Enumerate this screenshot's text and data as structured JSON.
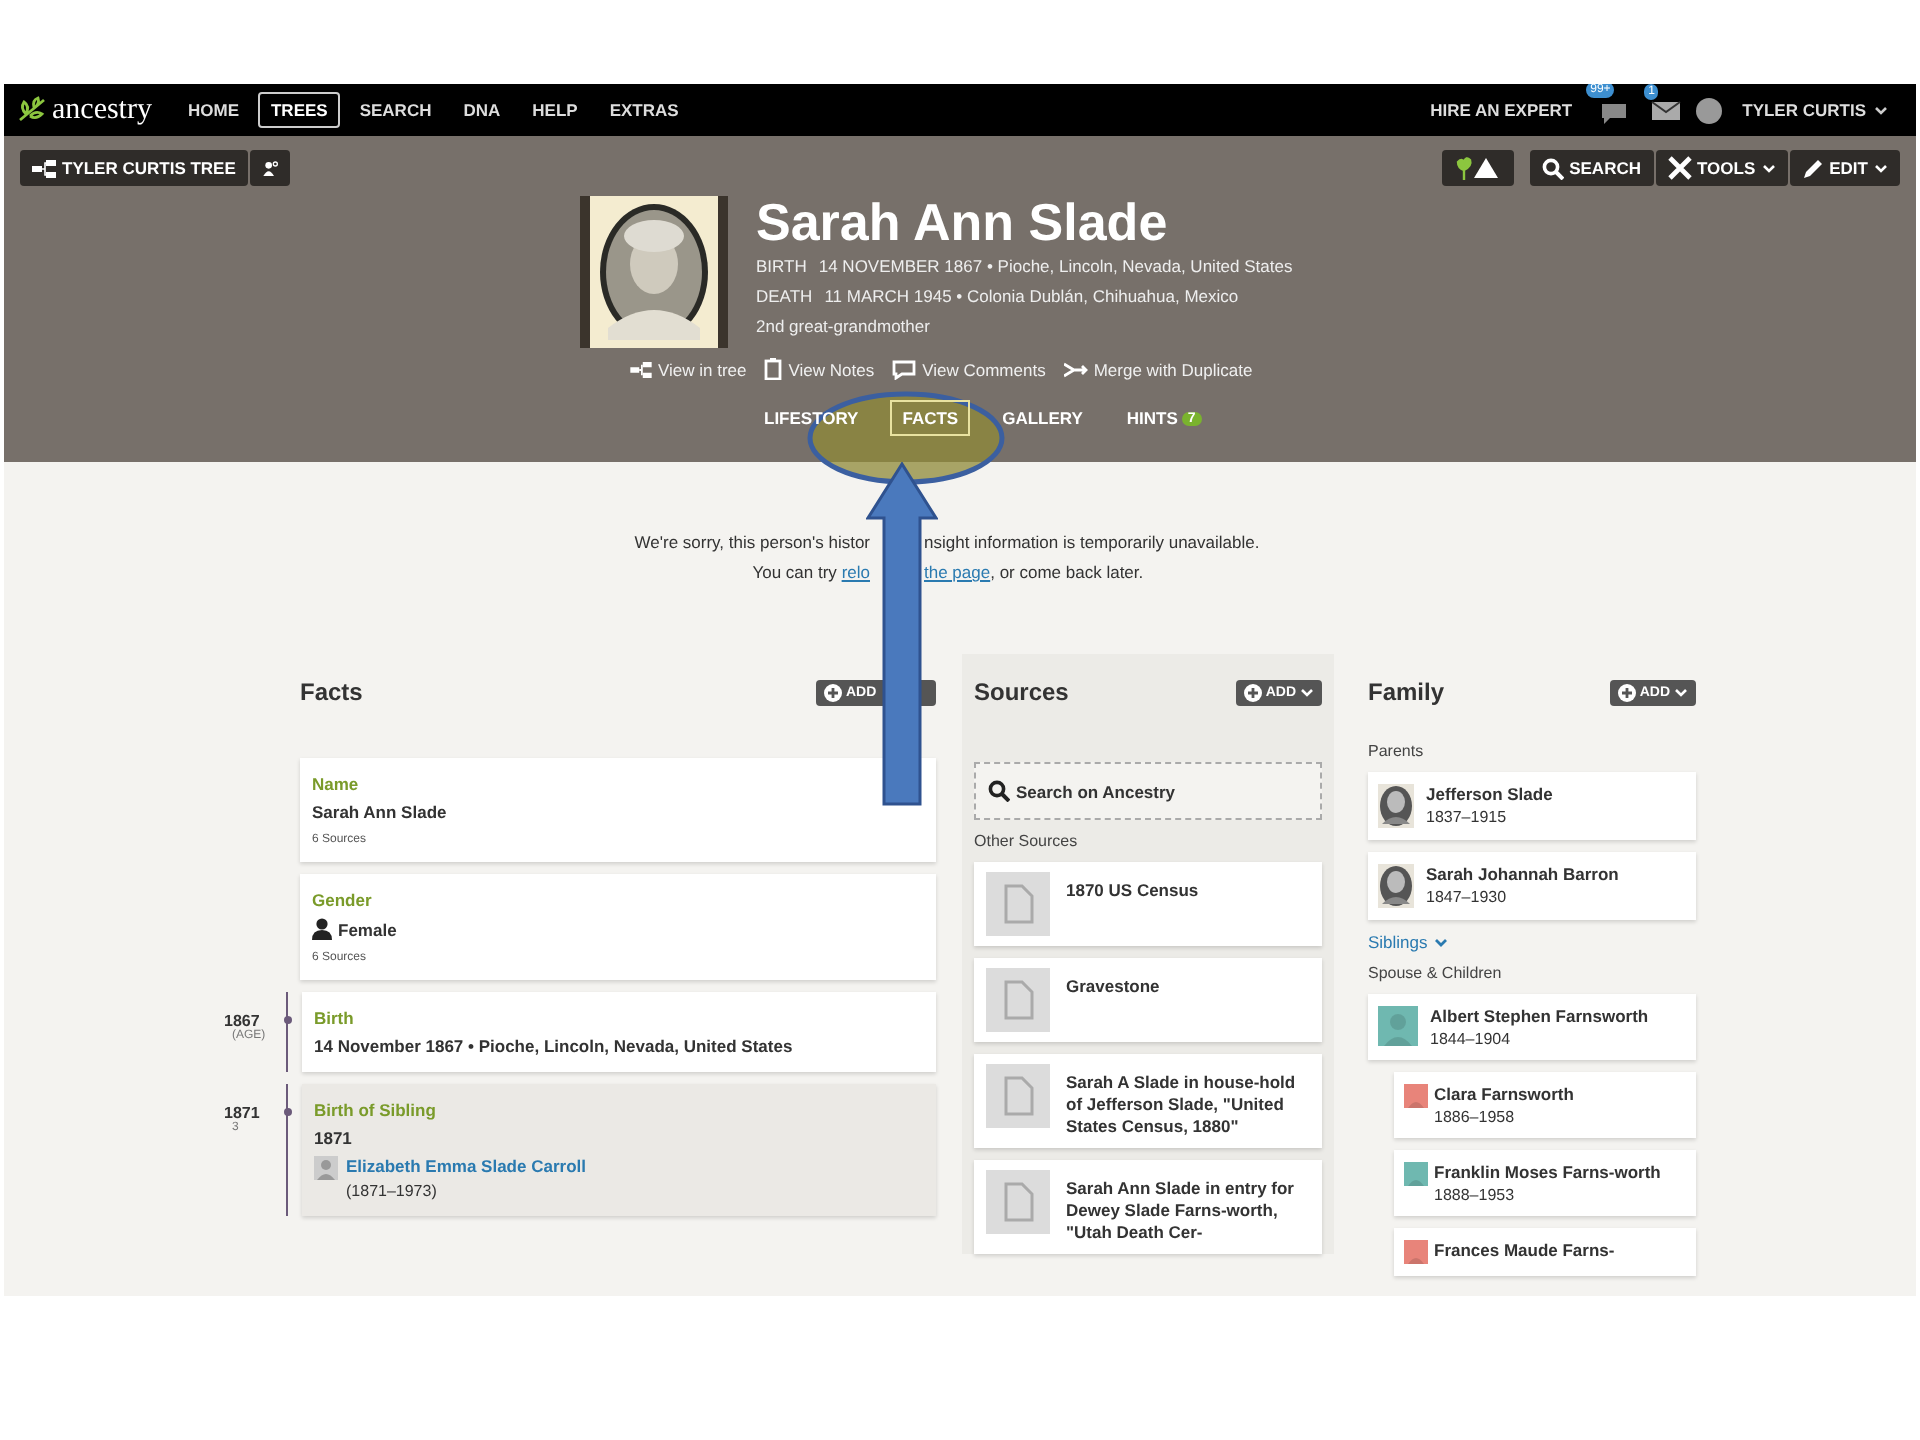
{
  "nav": {
    "logo": "ancestry",
    "items": [
      {
        "label": "HOME",
        "selected": false
      },
      {
        "label": "TREES",
        "selected": true
      },
      {
        "label": "SEARCH",
        "selected": false
      },
      {
        "label": "DNA",
        "selected": false
      },
      {
        "label": "HELP",
        "selected": false
      },
      {
        "label": "EXTRAS",
        "selected": false
      }
    ],
    "hire": "HIRE AN EXPERT",
    "hint_count": "99+",
    "message_count": "1",
    "user": "TYLER CURTIS"
  },
  "toolbar": {
    "tree": "TYLER CURTIS TREE",
    "search": "SEARCH",
    "tools": "TOOLS",
    "edit": "EDIT"
  },
  "person": {
    "name": "Sarah Ann Slade",
    "events": [
      {
        "label": "BIRTH",
        "value": "14 NOVEMBER 1867 • Pioche, Lincoln, Nevada, United States"
      },
      {
        "label": "DEATH",
        "value": "11 MARCH 1945 • Colonia Dublán, Chihuahua, Mexico"
      }
    ],
    "relation": "2nd great-grandmother",
    "links": [
      {
        "kind": "tree",
        "label": "View in tree"
      },
      {
        "kind": "notes",
        "label": "View Notes"
      },
      {
        "kind": "comments",
        "label": "View Comments"
      },
      {
        "kind": "merge",
        "label": "Merge with Duplicate"
      }
    ],
    "tabs": [
      {
        "label": "LIFESTORY",
        "selected": false
      },
      {
        "label": "FACTS",
        "selected": true
      },
      {
        "label": "GALLERY",
        "selected": false
      },
      {
        "label": "HINTS",
        "selected": false,
        "badge": "7"
      }
    ]
  },
  "notice": {
    "line_1_start": "We're sorry, this person's histor",
    "line_1_end": "nsight information is temporarily unavailable.",
    "line_2_start": "You can try",
    "link_start": "relo",
    "link_end": "the page",
    "line_2_end": ", or come back later."
  },
  "facts": {
    "title": "Facts",
    "add": "ADD",
    "items": [
      {
        "kind": "fact",
        "label": "Name",
        "value": "Sarah Ann Slade",
        "sources": "6 Sources"
      },
      {
        "kind": "gender",
        "label": "Gender",
        "value": "Female",
        "sources": "6 Sources"
      },
      {
        "kind": "fact",
        "label": "Birth",
        "value": "14 November 1867 • Pioche, Lincoln, Nevada, United States",
        "year": "1867",
        "age": "(AGE)"
      },
      {
        "kind": "relative",
        "label": "Birth of Sibling",
        "value": "1871",
        "year": "1871",
        "age": "3",
        "relative": "Elizabeth Emma Slade Carroll",
        "dates": "(1871–1973)"
      }
    ]
  },
  "sources": {
    "title": "Sources",
    "add": "ADD",
    "search": "Search on Ancestry",
    "other_label": "Other Sources",
    "items": [
      "1870 US Census",
      "Gravestone",
      "Sarah A Slade in house-hold of Jefferson Slade, \"United States Census, 1880\"",
      "Sarah Ann Slade in entry for Dewey Slade Farns-worth, \"Utah Death Cer-"
    ]
  },
  "family": {
    "title": "Family",
    "add": "ADD",
    "parents_label": "Parents",
    "parents": [
      {
        "name": "Jefferson Slade",
        "dates": "1837–1915"
      },
      {
        "name": "Sarah Johannah Barron",
        "dates": "1847–1930"
      }
    ],
    "siblings": "Siblings",
    "spouse_label": "Spouse & Children",
    "spouses": [
      {
        "kind": "avatar",
        "color": "#6fb8b0",
        "name": "Albert Stephen Farnsworth",
        "dates": "1844–1904",
        "children": [
          {
            "kind": "avatar",
            "color": "#e8847a",
            "name": "Clara Farnsworth",
            "dates": "1886–1958"
          },
          {
            "kind": "avatar",
            "color": "#6fb8b0",
            "name": "Franklin Moses Farns-worth",
            "dates": "1888–1953"
          },
          {
            "kind": "avatar",
            "color": "#e8847a",
            "name": "Frances Maude Farns-"
          }
        ]
      }
    ]
  }
}
